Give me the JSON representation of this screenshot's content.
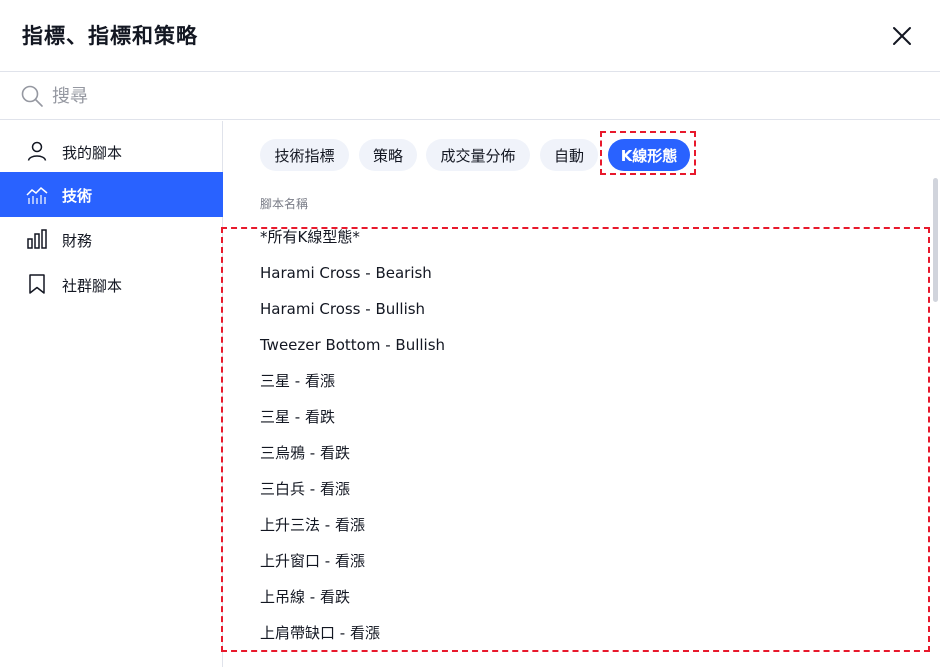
{
  "dialog": {
    "title": "指標、指標和策略"
  },
  "search": {
    "placeholder": "搜尋"
  },
  "sidebar": {
    "items": [
      {
        "label": "我的腳本",
        "icon": "user-icon"
      },
      {
        "label": "技術",
        "icon": "chart-line-icon",
        "active": true
      },
      {
        "label": "財務",
        "icon": "bar-chart-icon"
      },
      {
        "label": "社群腳本",
        "icon": "bookmark-icon"
      }
    ]
  },
  "tabs": [
    {
      "label": "技術指標"
    },
    {
      "label": "策略"
    },
    {
      "label": "成交量分佈"
    },
    {
      "label": "自動"
    },
    {
      "label": "K線形態",
      "active": true
    }
  ],
  "list": {
    "column_header": "腳本名稱",
    "items": [
      "*所有K線型態*",
      "Harami Cross - Bearish",
      "Harami Cross - Bullish",
      "Tweezer Bottom - Bullish",
      "三星 - 看漲",
      "三星 - 看跌",
      "三烏鴉 - 看跌",
      "三白兵 - 看漲",
      "上升三法 - 看漲",
      "上升窗口 - 看漲",
      "上吊線 - 看跌",
      "上肩帶缺口 - 看漲"
    ]
  },
  "colors": {
    "accent": "#2962ff",
    "chip_bg": "#f0f3fa",
    "highlight": "#e8192c"
  }
}
